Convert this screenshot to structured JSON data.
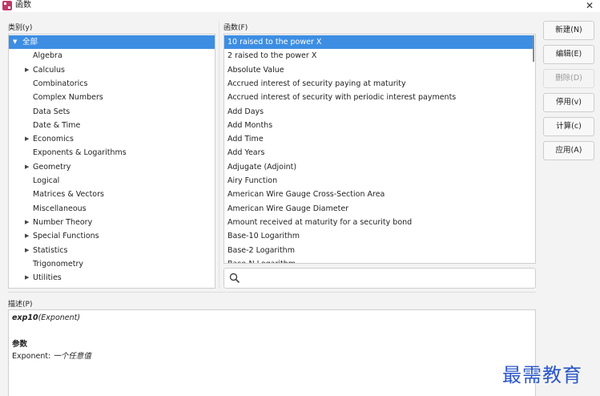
{
  "window": {
    "title": "函数",
    "close_glyph": "✕"
  },
  "categories": {
    "label": "类别(y)",
    "items": [
      {
        "label": "全部",
        "expander": "▼",
        "selected": true
      },
      {
        "label": "Algebra",
        "expander": ""
      },
      {
        "label": "Calculus",
        "expander": "▶"
      },
      {
        "label": "Combinatorics",
        "expander": ""
      },
      {
        "label": "Complex Numbers",
        "expander": ""
      },
      {
        "label": "Data Sets",
        "expander": ""
      },
      {
        "label": "Date & Time",
        "expander": ""
      },
      {
        "label": "Economics",
        "expander": "▶"
      },
      {
        "label": "Exponents & Logarithms",
        "expander": ""
      },
      {
        "label": "Geometry",
        "expander": "▶"
      },
      {
        "label": "Logical",
        "expander": ""
      },
      {
        "label": "Matrices & Vectors",
        "expander": ""
      },
      {
        "label": "Miscellaneous",
        "expander": ""
      },
      {
        "label": "Number Theory",
        "expander": "▶"
      },
      {
        "label": "Special Functions",
        "expander": "▶"
      },
      {
        "label": "Statistics",
        "expander": "▶"
      },
      {
        "label": "Trigonometry",
        "expander": ""
      },
      {
        "label": "Utilities",
        "expander": "▶"
      }
    ]
  },
  "functions": {
    "label": "函数(F)",
    "items": [
      {
        "label": "10 raised to the power X",
        "selected": true
      },
      {
        "label": "2 raised to the power X"
      },
      {
        "label": "Absolute Value"
      },
      {
        "label": "Accrued interest of security paying at maturity"
      },
      {
        "label": "Accrued interest of security with periodic interest payments"
      },
      {
        "label": "Add Days"
      },
      {
        "label": "Add Months"
      },
      {
        "label": "Add Time"
      },
      {
        "label": "Add Years"
      },
      {
        "label": "Adjugate (Adjoint)"
      },
      {
        "label": "Airy Function"
      },
      {
        "label": "American Wire Gauge Cross-Section Area"
      },
      {
        "label": "American Wire Gauge Diameter"
      },
      {
        "label": "Amount received at maturity for a security bond"
      },
      {
        "label": "Base-10 Logarithm"
      },
      {
        "label": "Base-2 Logarithm"
      },
      {
        "label": "Base-N Logarithm"
      }
    ],
    "search": {
      "icon": "search-icon",
      "value": "",
      "placeholder": ""
    }
  },
  "description": {
    "label": "描述(P)",
    "function_name": "exp10",
    "signature": "(Exponent)",
    "params_heading": "参数",
    "param_name": "Exponent:",
    "param_desc": "一个任意值"
  },
  "buttons": [
    {
      "label": "新建(N)",
      "enabled": true
    },
    {
      "label": "编辑(E)",
      "enabled": true
    },
    {
      "label": "删除(D)",
      "enabled": false
    },
    {
      "label": "停用(v)",
      "enabled": true
    },
    {
      "label": "计算(c)",
      "enabled": true
    },
    {
      "label": "应用(A)",
      "enabled": true
    }
  ],
  "watermark": "最需教育",
  "colors": {
    "selection": "#3d8ee3",
    "watermark": "#2a57c8"
  }
}
